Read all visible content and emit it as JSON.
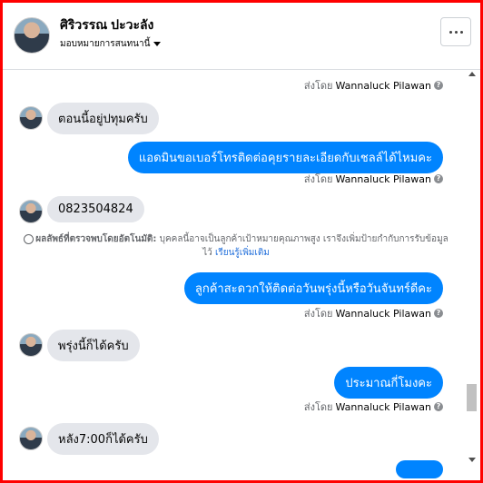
{
  "header": {
    "name": "ศิริวรรณ ปะวะลัง",
    "assign_label": "มอบหมายการสนทนานี้",
    "more_label": "More options"
  },
  "sent_by": {
    "prefix": "ส่งโดย",
    "sender": "Wannaluck Pilawan"
  },
  "messages": [
    {
      "dir": "in",
      "text": "ตอนนี้อยู่ปทุมครับ"
    },
    {
      "dir": "out",
      "text": "แอดมินขอเบอร์โทรติดต่อคุยรายละเอียดกับเชลล์ได้ไหมคะ"
    },
    {
      "dir": "in",
      "text": "0823504824"
    },
    {
      "dir": "out",
      "text": "ลูกค้าสะดวกให้ติดต่อวันพรุ่งนี้หรือวันจันทร์ดีคะ"
    },
    {
      "dir": "in",
      "text": "พรุ่งนี้ก็ได้ครับ"
    },
    {
      "dir": "out",
      "text": "ประมาณกี่โมงคะ"
    },
    {
      "dir": "in",
      "text": "หลัง7:00ก็ได้ครับ"
    }
  ],
  "auto_note": {
    "title": "ผลลัพธ์ที่ตรวจพบโดยอัตโนมัติ:",
    "body": "บุคคลนี้อาจเป็นลูกค้าเป้าหมายคุณภาพสูง เราจึงเพิ่มป้ายกำกับการรับข้อมูลไว้",
    "link": "เรียนรู้เพิ่มเติม"
  },
  "colors": {
    "outgoing_bubble": "#0084ff",
    "incoming_bubble": "#e4e6eb",
    "border": "#ff0000"
  }
}
